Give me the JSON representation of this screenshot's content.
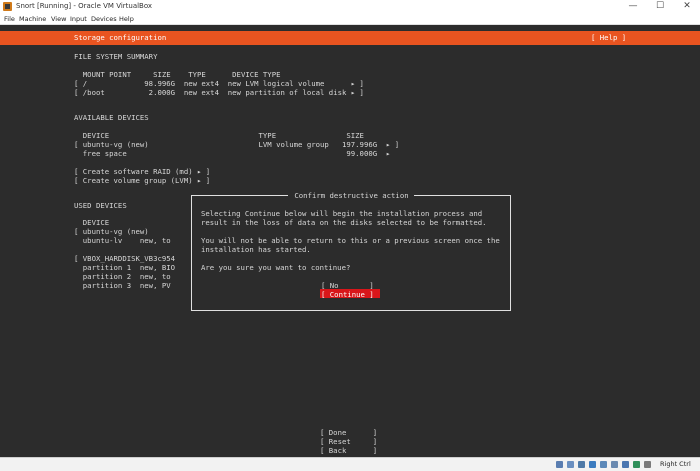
{
  "window": {
    "title": "Snort  [Running] - Oracle VM VirtualBox",
    "minimize": "—",
    "maximize": "☐",
    "close": "✕"
  },
  "menu": [
    "File",
    "Machine",
    "View",
    "Input",
    "Devices",
    "Help"
  ],
  "header": {
    "title": "Storage configuration",
    "help": "[ Help ]"
  },
  "fs_summary": {
    "title": "FILE SYSTEM SUMMARY",
    "columns": "  MOUNT POINT     SIZE    TYPE      DEVICE TYPE",
    "rows": [
      "[ /             98.996G  new ext4  new LVM logical volume      ▸ ]",
      "[ /boot          2.000G  new ext4  new partition of local disk ▸ ]"
    ]
  },
  "available": {
    "title": "AVAILABLE DEVICES",
    "columns": "  DEVICE                                  TYPE                SIZE",
    "rows": [
      "[ ubuntu-vg (new)                         LVM volume group   197.996G  ▸ ]",
      "  free space                                                  99.000G  ▸"
    ],
    "actions": [
      "[ Create software RAID (md) ▸ ]",
      "[ Create volume group (LVM) ▸ ]"
    ]
  },
  "used": {
    "title": "USED DEVICES",
    "rows": [
      "  DEVICE",
      "[ ubuntu-vg (new)",
      "  ubuntu-lv    new, to",
      "",
      "[ VBOX_HARDDISK_VB3c954",
      "  partition 1  new, BIO",
      "  partition 2  new, to",
      "  partition 3  new, PV"
    ]
  },
  "dialog": {
    "title": " Confirm destructive action ",
    "line1": "Selecting Continue below will begin the installation process and",
    "line2": "result in the loss of data on the disks selected to be formatted.",
    "line3": "You will not be able to return to this or a previous screen once the",
    "line4": "installation has started.",
    "question": "Are you sure you want to continue?",
    "no": "[ No       ]",
    "continue": "[ Continue ]"
  },
  "footer": {
    "done": "[ Done      ]",
    "reset": "[ Reset     ]",
    "back": "[ Back      ]"
  },
  "statusbar": {
    "right_ctrl": "Right Ctrl"
  },
  "colors": {
    "accent": "#e95420",
    "selected": "#d8161a",
    "screen_bg": "#2c2c2c"
  }
}
